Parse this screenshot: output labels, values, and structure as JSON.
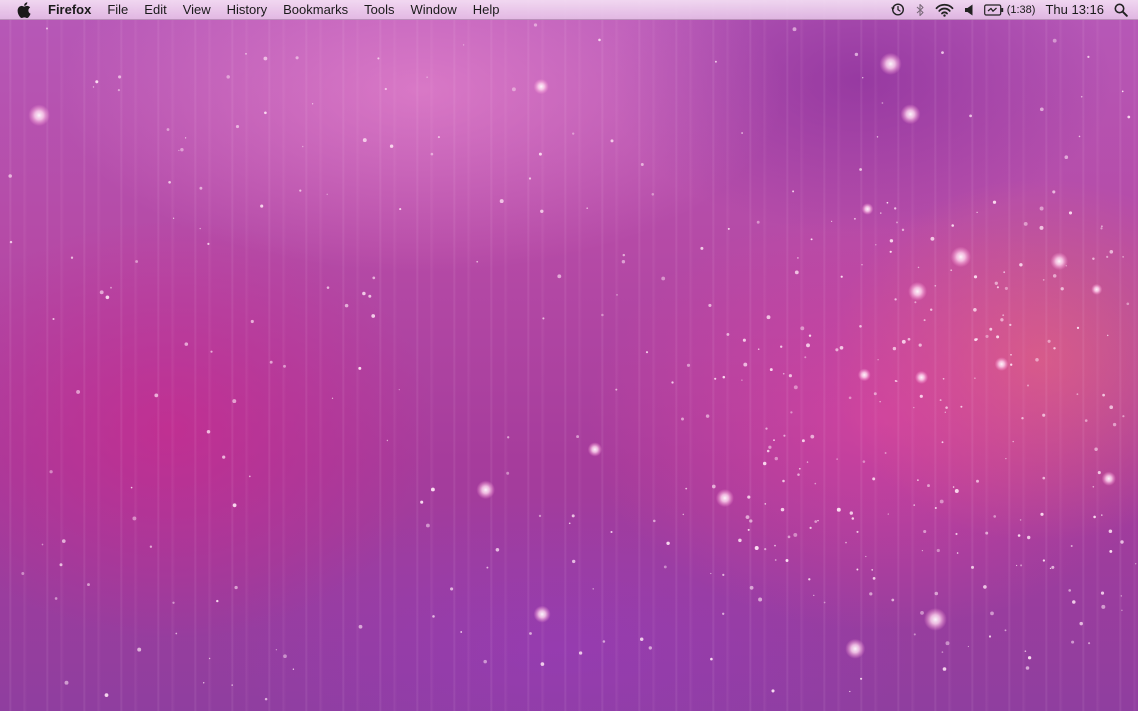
{
  "menubar": {
    "apple_icon": "apple-icon",
    "app_name": "Firefox",
    "menus": [
      {
        "id": "file",
        "label": "File"
      },
      {
        "id": "edit",
        "label": "Edit"
      },
      {
        "id": "view",
        "label": "View"
      },
      {
        "id": "history",
        "label": "History"
      },
      {
        "id": "bookmarks",
        "label": "Bookmarks"
      },
      {
        "id": "tools",
        "label": "Tools"
      },
      {
        "id": "window",
        "label": "Window"
      },
      {
        "id": "help",
        "label": "Help"
      }
    ],
    "status": {
      "time_machine_icon": "time-machine-icon",
      "bluetooth_icon": "bluetooth-icon",
      "wifi_icon": "wifi-icon",
      "volume_icon": "volume-icon",
      "battery_icon": "battery-icon",
      "battery_time": "(1:38)",
      "clock": "Thu 13:16",
      "spotlight_icon": "spotlight-search-icon"
    }
  },
  "desktop": {
    "wallpaper_colors": [
      "#b659b8",
      "#a63c9c",
      "#e84aa4",
      "#f07a6e",
      "#8f3e9f"
    ]
  }
}
